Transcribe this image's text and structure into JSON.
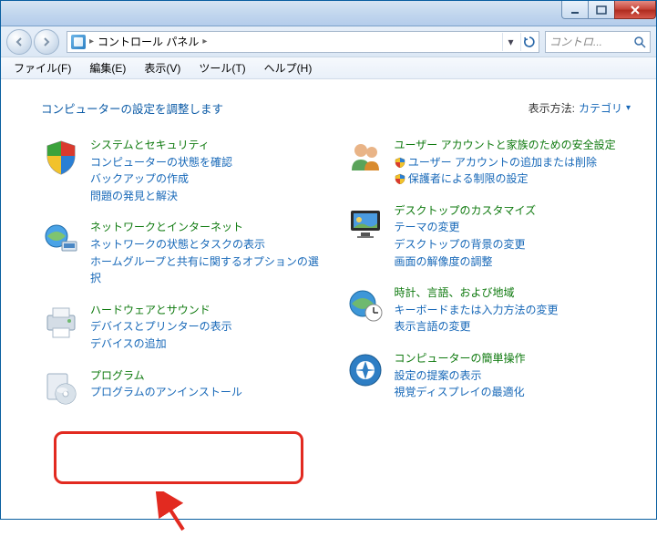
{
  "titlebar": {
    "minimize": "_",
    "maximize": "□",
    "close": "×"
  },
  "nav": {
    "breadcrumb_root": "コントロール パネル",
    "search_placeholder": "コントロ...",
    "dropdown_glyph": "▾",
    "refresh_glyph": "↻"
  },
  "menu": {
    "file": "ファイル(F)",
    "edit": "編集(E)",
    "view": "表示(V)",
    "tools": "ツール(T)",
    "help": "ヘルプ(H)"
  },
  "header": {
    "title": "コンピューターの設定を調整します",
    "view_label": "表示方法:",
    "view_value": "カテゴリ",
    "view_caret": "▾"
  },
  "left": [
    {
      "title": "システムとセキュリティ",
      "links": [
        "コンピューターの状態を確認",
        "バックアップの作成",
        "問題の発見と解決"
      ]
    },
    {
      "title": "ネットワークとインターネット",
      "links": [
        "ネットワークの状態とタスクの表示",
        "ホームグループと共有に関するオプションの選択"
      ]
    },
    {
      "title": "ハードウェアとサウンド",
      "links": [
        "デバイスとプリンターの表示",
        "デバイスの追加"
      ]
    },
    {
      "title": "プログラム",
      "links": [
        "プログラムのアンインストール"
      ]
    }
  ],
  "right": [
    {
      "title": "ユーザー アカウントと家族のための安全設定",
      "links": [
        "ユーザー アカウントの追加または削除",
        "保護者による制限の設定"
      ],
      "shielded": [
        true,
        true
      ]
    },
    {
      "title": "デスクトップのカスタマイズ",
      "links": [
        "テーマの変更",
        "デスクトップの背景の変更",
        "画面の解像度の調整"
      ]
    },
    {
      "title": "時計、言語、および地域",
      "links": [
        "キーボードまたは入力方法の変更",
        "表示言語の変更"
      ]
    },
    {
      "title": "コンピューターの簡単操作",
      "links": [
        "設定の提案の表示",
        "視覚ディスプレイの最適化"
      ]
    }
  ]
}
